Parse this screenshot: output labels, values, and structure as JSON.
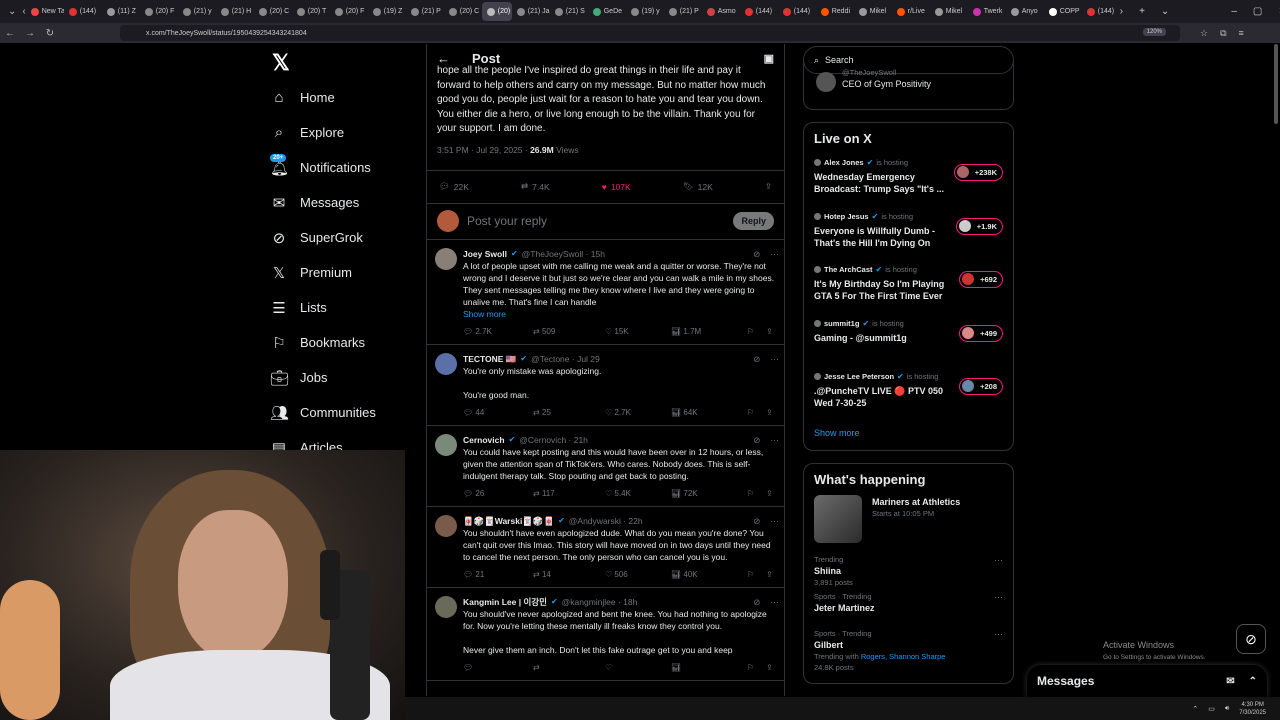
{
  "browser": {
    "tabs": [
      "New Ta",
      "(144)",
      "(11) Z",
      "(20) F",
      "(21) y",
      "(21) H",
      "(20) C",
      "(20) T",
      "(20) F",
      "(19) Z",
      "(21) P",
      "(20) C",
      "(20)",
      "(21) Ja",
      "(21) S",
      "GeDe",
      "(19) y",
      "(21) P",
      "Asmo",
      "(144)",
      "(144)",
      "Reddi",
      "Mikel",
      "r/Live",
      "Mikel",
      "Twerk",
      "Anyo",
      "COPP",
      "(144)"
    ],
    "url": "x.com/TheJoeySwoll/status/1950439254343241804",
    "zoom": "120%"
  },
  "nav": {
    "items": [
      {
        "label": "Home",
        "icon": "home-icon"
      },
      {
        "label": "Explore",
        "icon": "search-icon"
      },
      {
        "label": "Notifications",
        "icon": "bell-icon",
        "badge": "20+"
      },
      {
        "label": "Messages",
        "icon": "envelope-icon"
      },
      {
        "label": "SuperGrok",
        "icon": "grok-icon"
      },
      {
        "label": "Premium",
        "icon": "x-icon"
      },
      {
        "label": "Lists",
        "icon": "list-icon"
      },
      {
        "label": "Bookmarks",
        "icon": "bookmark-icon"
      },
      {
        "label": "Jobs",
        "icon": "briefcase-icon"
      },
      {
        "label": "Communities",
        "icon": "people-icon"
      },
      {
        "label": "Articles",
        "icon": "article-icon"
      }
    ]
  },
  "post": {
    "header": "Post",
    "text": "hope all the people I've inspired do great things in their life and pay it forward to help others and carry on my message. But no matter how much good you do, people just wait for a reason to hate you and tear you down. You either die a hero, or live long enough to be the villain. Thank you for your support. I am done.",
    "time": "3:51 PM · Jul 29, 2025 · ",
    "views_count": "26.9M",
    "views_label": " Views",
    "replies": "22K",
    "reposts": "7.4K",
    "likes": "107K",
    "bookmarks": "12K",
    "reply_placeholder": "Post your reply",
    "reply_button": "Reply"
  },
  "replies": [
    {
      "name": "Joey Swoll",
      "handle": "@TheJoeySwoll · 15h",
      "text": "A lot of people upset with me calling me weak and a quitter or worse. They're not wrong and I deserve it but just so we're clear and you can walk a mile in my shoes. They sent messages telling me they know where I live and they were going to unalive me. That's fine I can handle",
      "show_more": "Show more",
      "replies": "2.7K",
      "reposts": "509",
      "likes": "15K",
      "views": "1.7M",
      "avatar_color": "#8a7f76"
    },
    {
      "name": "TECTONE 🇺🇸",
      "handle": "@Tectone · Jul 29",
      "text": "You're only mistake was apologizing.\n\nYou're good man.",
      "show_more": "",
      "replies": "44",
      "reposts": "25",
      "likes": "2.7K",
      "views": "64K",
      "avatar_color": "#5b6fa8"
    },
    {
      "name": "Cernovich",
      "handle": "@Cernovich · 21h",
      "text": "You could have kept posting and this would have been over in 12 hours, or less, given the attention span of TikTok'ers. Who cares. Nobody does. This is self-indulgent therapy talk. Stop pouting and get back to posting.",
      "show_more": "",
      "replies": "26",
      "reposts": "117",
      "likes": "5.4K",
      "views": "72K",
      "avatar_color": "#7a8a7a"
    },
    {
      "name": "🀄🎲🃏Warski🃏🎲🀄",
      "handle": "@Andywarski · 22h",
      "text": "You shouldn't have even apologized dude. What do you mean you're done? You can't quit over this lmao. This story will have moved on in two days until they need to cancel the next person. The only person who can cancel you is you.",
      "show_more": "",
      "replies": "21",
      "reposts": "14",
      "likes": "506",
      "views": "40K",
      "avatar_color": "#7a5a4a"
    },
    {
      "name": "Kangmin Lee | 이강민",
      "handle": "@kangminjlee · 18h",
      "text": "You should've never apologized and bent the knee. You had nothing to apologize for. Now you're letting these mentally ill freaks know they control you.\n\nNever give them an inch. Don't let this fake outrage get to you and keep",
      "show_more": "",
      "replies": "",
      "reposts": "",
      "likes": "",
      "views": "",
      "avatar_color": "#6a6a5a"
    }
  ],
  "right": {
    "search_placeholder": "Search",
    "profile_handle": "@TheJoeySwoll",
    "profile_bio": "CEO of Gym Positivity",
    "live_title": "Live on X",
    "live": [
      {
        "host": "Alex Jones",
        "status": "is hosting",
        "title": "Wednesday Emergency Broadcast: Trump Says \"It's ...",
        "count": "+238K"
      },
      {
        "host": "Hotep Jesus",
        "status": "is hosting",
        "title": "Everyone is Willfully Dumb - That's the Hill I'm Dying On",
        "count": "+1.9K"
      },
      {
        "host": "The ArchCast",
        "status": "is hosting",
        "title": "It's My Birthday So I'm Playing GTA 5 For The First Time Ever",
        "count": "+692"
      },
      {
        "host": "summit1g",
        "status": "is hosting",
        "title": "Gaming - @summit1g",
        "count": "+499"
      },
      {
        "host": "Jesse Lee Peterson",
        "status": "is hosting",
        "title": ".@PuncheTV LIVE 🔴 PTV 050 Wed 7-30-25",
        "count": "+208"
      }
    ],
    "show_more": "Show more",
    "happening_title": "What's happening",
    "event_name": "Mariners at Athletics",
    "event_time": "Starts at 10:05 PM",
    "trends": [
      {
        "context": "Trending",
        "name": "Shiina",
        "posts": "3,891 posts",
        "with": "",
        "links": ""
      },
      {
        "context": "Sports · Trending",
        "name": "Jeter Martinez",
        "posts": "",
        "with": "",
        "links": ""
      },
      {
        "context": "Sports · Trending",
        "name": "Gilbert",
        "posts": "24.8K posts",
        "with": "Trending with ",
        "links": "Rogers, Shannon Sharpe"
      }
    ]
  },
  "overlay": {
    "activate_title": "Activate Windows",
    "activate_sub": "Go to Settings to activate Windows.",
    "messages_label": "Messages",
    "clock_time": "4:30 PM",
    "clock_date": "7/30/2025"
  }
}
